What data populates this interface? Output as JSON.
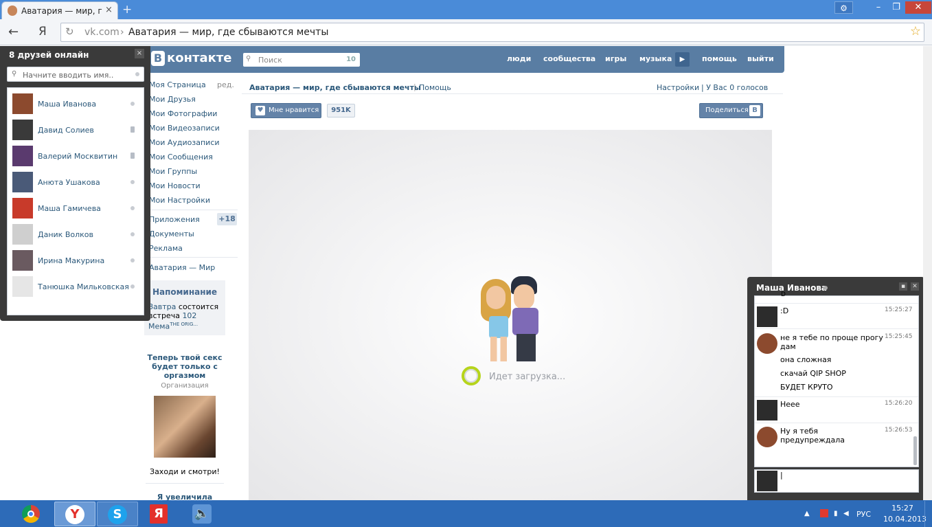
{
  "browser": {
    "tab_title": "Аватария — мир, где",
    "tab_close": "×",
    "new_tab": "+",
    "address_domain": "vk.com",
    "address_sep": "›",
    "address_title": "Аватария — мир, где сбываются мечты",
    "window_min": "–",
    "window_max": "❐",
    "window_close": "✕"
  },
  "vk_header": {
    "logo_b": "В",
    "logo_text": "контакте",
    "search_placeholder": "Поиск",
    "search_count": "10",
    "nav": [
      "люди",
      "сообщества",
      "игры",
      "музыка",
      "помощь",
      "выйти"
    ]
  },
  "left_menu": {
    "edit": "ред.",
    "items": [
      "Моя Страница",
      "Мои Друзья",
      "Мои Фотографии",
      "Мои Видеозаписи",
      "Мои Аудиозаписи",
      "Мои Сообщения",
      "Мои Группы",
      "Мои Новости",
      "Мои Настройки"
    ],
    "items2": [
      "Приложения",
      "Документы",
      "Реклама"
    ],
    "apps_badge": "+18",
    "app_link": "Аватария — Мир",
    "reminder_title": "Напоминание",
    "reminder_pre": "Завтра",
    "reminder_mid": " состоится встреча ",
    "reminder_link": "102 Мема",
    "reminder_small": "THE ORIG...",
    "ad1_title": "Теперь твой секс будет только с оргазмом",
    "ad1_sub": "Организация",
    "ad1_caption": "Заходи и смотри!",
    "ad2_title": "Я увеличила"
  },
  "app": {
    "title": "Аватария — мир, где сбываются мечты",
    "help": "Помощь",
    "settings": "Настройки",
    "votes": "| У Вас 0 голосов",
    "like_label": "Мне нравится",
    "like_count": "951K",
    "share_label": "Поделиться",
    "share_icon": "В",
    "loading": "Идет загрузка..."
  },
  "friends": {
    "header": "8 друзей онлайн",
    "search_placeholder": "Начните вводить имя..",
    "list": [
      {
        "name": "Маша Иванова",
        "status": "online",
        "color": "#8c4a2e"
      },
      {
        "name": "Давид Солиев",
        "status": "mobile",
        "color": "#3a3a3a"
      },
      {
        "name": "Валерий Москвитин",
        "status": "mobile",
        "color": "#5a3a6e"
      },
      {
        "name": "Анюта Ушакова",
        "status": "online",
        "color": "#4a5a78"
      },
      {
        "name": "Маша Гамичева",
        "status": "online",
        "color": "#c83a2a"
      },
      {
        "name": "Даник Волков",
        "status": "online",
        "color": "#cfcfcf"
      },
      {
        "name": "Ирина Макурина",
        "status": "online",
        "color": "#6a5a60"
      },
      {
        "name": "Танюшка Мильковская",
        "status": "online",
        "color": "#e6e6e6"
      }
    ]
  },
  "chat": {
    "header": "Маша Иванова",
    "min": "▪",
    "close": "✕",
    "top_cut": "D",
    "messages": [
      {
        "lines": [
          ":D"
        ],
        "time": "15:25:27"
      },
      {
        "lines": [
          "не я тебе по проще прогу дам",
          "она сложная",
          "скачай QIP SHOP",
          "БУДЕТ КРУТО"
        ],
        "time": "15:25:45"
      },
      {
        "lines": [
          "Неее"
        ],
        "time": "15:26:20"
      },
      {
        "lines": [
          "Ну я тебя предупреждала"
        ],
        "time": "15:26:53"
      }
    ],
    "input_value": "|"
  },
  "taskbar": {
    "lang": "РУС",
    "time": "15:27",
    "date": "10.04.2013",
    "apps": [
      "chrome-icon",
      "yandex-browser-icon",
      "skype-icon",
      "yandex-icon",
      "sound-icon"
    ]
  }
}
